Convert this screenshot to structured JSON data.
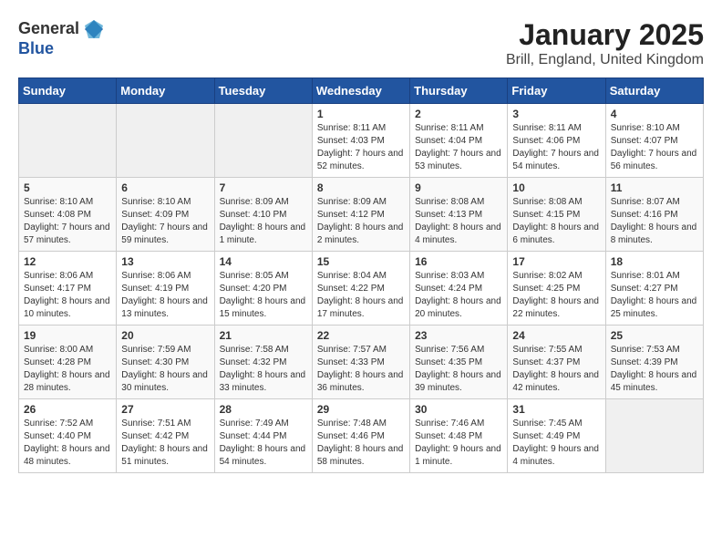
{
  "logo": {
    "general": "General",
    "blue": "Blue"
  },
  "title": "January 2025",
  "subtitle": "Brill, England, United Kingdom",
  "days_of_week": [
    "Sunday",
    "Monday",
    "Tuesday",
    "Wednesday",
    "Thursday",
    "Friday",
    "Saturday"
  ],
  "weeks": [
    [
      {
        "day": "",
        "info": ""
      },
      {
        "day": "",
        "info": ""
      },
      {
        "day": "",
        "info": ""
      },
      {
        "day": "1",
        "info": "Sunrise: 8:11 AM\nSunset: 4:03 PM\nDaylight: 7 hours and 52 minutes."
      },
      {
        "day": "2",
        "info": "Sunrise: 8:11 AM\nSunset: 4:04 PM\nDaylight: 7 hours and 53 minutes."
      },
      {
        "day": "3",
        "info": "Sunrise: 8:11 AM\nSunset: 4:06 PM\nDaylight: 7 hours and 54 minutes."
      },
      {
        "day": "4",
        "info": "Sunrise: 8:10 AM\nSunset: 4:07 PM\nDaylight: 7 hours and 56 minutes."
      }
    ],
    [
      {
        "day": "5",
        "info": "Sunrise: 8:10 AM\nSunset: 4:08 PM\nDaylight: 7 hours and 57 minutes."
      },
      {
        "day": "6",
        "info": "Sunrise: 8:10 AM\nSunset: 4:09 PM\nDaylight: 7 hours and 59 minutes."
      },
      {
        "day": "7",
        "info": "Sunrise: 8:09 AM\nSunset: 4:10 PM\nDaylight: 8 hours and 1 minute."
      },
      {
        "day": "8",
        "info": "Sunrise: 8:09 AM\nSunset: 4:12 PM\nDaylight: 8 hours and 2 minutes."
      },
      {
        "day": "9",
        "info": "Sunrise: 8:08 AM\nSunset: 4:13 PM\nDaylight: 8 hours and 4 minutes."
      },
      {
        "day": "10",
        "info": "Sunrise: 8:08 AM\nSunset: 4:15 PM\nDaylight: 8 hours and 6 minutes."
      },
      {
        "day": "11",
        "info": "Sunrise: 8:07 AM\nSunset: 4:16 PM\nDaylight: 8 hours and 8 minutes."
      }
    ],
    [
      {
        "day": "12",
        "info": "Sunrise: 8:06 AM\nSunset: 4:17 PM\nDaylight: 8 hours and 10 minutes."
      },
      {
        "day": "13",
        "info": "Sunrise: 8:06 AM\nSunset: 4:19 PM\nDaylight: 8 hours and 13 minutes."
      },
      {
        "day": "14",
        "info": "Sunrise: 8:05 AM\nSunset: 4:20 PM\nDaylight: 8 hours and 15 minutes."
      },
      {
        "day": "15",
        "info": "Sunrise: 8:04 AM\nSunset: 4:22 PM\nDaylight: 8 hours and 17 minutes."
      },
      {
        "day": "16",
        "info": "Sunrise: 8:03 AM\nSunset: 4:24 PM\nDaylight: 8 hours and 20 minutes."
      },
      {
        "day": "17",
        "info": "Sunrise: 8:02 AM\nSunset: 4:25 PM\nDaylight: 8 hours and 22 minutes."
      },
      {
        "day": "18",
        "info": "Sunrise: 8:01 AM\nSunset: 4:27 PM\nDaylight: 8 hours and 25 minutes."
      }
    ],
    [
      {
        "day": "19",
        "info": "Sunrise: 8:00 AM\nSunset: 4:28 PM\nDaylight: 8 hours and 28 minutes."
      },
      {
        "day": "20",
        "info": "Sunrise: 7:59 AM\nSunset: 4:30 PM\nDaylight: 8 hours and 30 minutes."
      },
      {
        "day": "21",
        "info": "Sunrise: 7:58 AM\nSunset: 4:32 PM\nDaylight: 8 hours and 33 minutes."
      },
      {
        "day": "22",
        "info": "Sunrise: 7:57 AM\nSunset: 4:33 PM\nDaylight: 8 hours and 36 minutes."
      },
      {
        "day": "23",
        "info": "Sunrise: 7:56 AM\nSunset: 4:35 PM\nDaylight: 8 hours and 39 minutes."
      },
      {
        "day": "24",
        "info": "Sunrise: 7:55 AM\nSunset: 4:37 PM\nDaylight: 8 hours and 42 minutes."
      },
      {
        "day": "25",
        "info": "Sunrise: 7:53 AM\nSunset: 4:39 PM\nDaylight: 8 hours and 45 minutes."
      }
    ],
    [
      {
        "day": "26",
        "info": "Sunrise: 7:52 AM\nSunset: 4:40 PM\nDaylight: 8 hours and 48 minutes."
      },
      {
        "day": "27",
        "info": "Sunrise: 7:51 AM\nSunset: 4:42 PM\nDaylight: 8 hours and 51 minutes."
      },
      {
        "day": "28",
        "info": "Sunrise: 7:49 AM\nSunset: 4:44 PM\nDaylight: 8 hours and 54 minutes."
      },
      {
        "day": "29",
        "info": "Sunrise: 7:48 AM\nSunset: 4:46 PM\nDaylight: 8 hours and 58 minutes."
      },
      {
        "day": "30",
        "info": "Sunrise: 7:46 AM\nSunset: 4:48 PM\nDaylight: 9 hours and 1 minute."
      },
      {
        "day": "31",
        "info": "Sunrise: 7:45 AM\nSunset: 4:49 PM\nDaylight: 9 hours and 4 minutes."
      },
      {
        "day": "",
        "info": ""
      }
    ]
  ]
}
